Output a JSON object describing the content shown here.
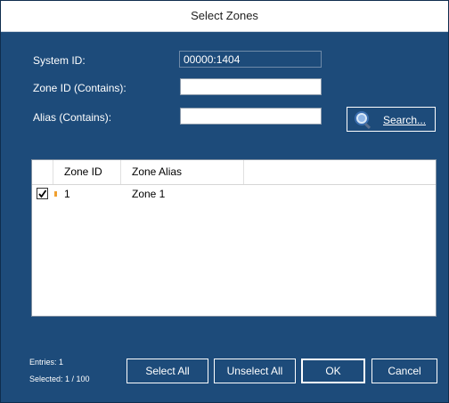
{
  "window": {
    "title": "Select Zones"
  },
  "form": {
    "system_id_label": "System ID:",
    "system_id_value": "00000:1404",
    "zone_id_label": "Zone ID (Contains):",
    "zone_id_value": "",
    "alias_label": "Alias (Contains):",
    "alias_value": "",
    "search_label": "Search..."
  },
  "grid": {
    "columns": [
      "Zone ID",
      "Zone Alias"
    ],
    "rows": [
      {
        "checked": true,
        "zone_id": "1",
        "zone_alias": "Zone 1"
      }
    ]
  },
  "status": {
    "entries": "Entries: 1",
    "selected": "Selected: 1 / 100"
  },
  "buttons": {
    "select_all": "Select All",
    "unselect_all": "Unselect All",
    "ok": "OK",
    "cancel": "Cancel"
  },
  "icons": {
    "search": "magnifier-icon",
    "check": "checkmark-icon"
  },
  "colors": {
    "background": "#1d4b7a",
    "titlebar": "#ffffff"
  }
}
